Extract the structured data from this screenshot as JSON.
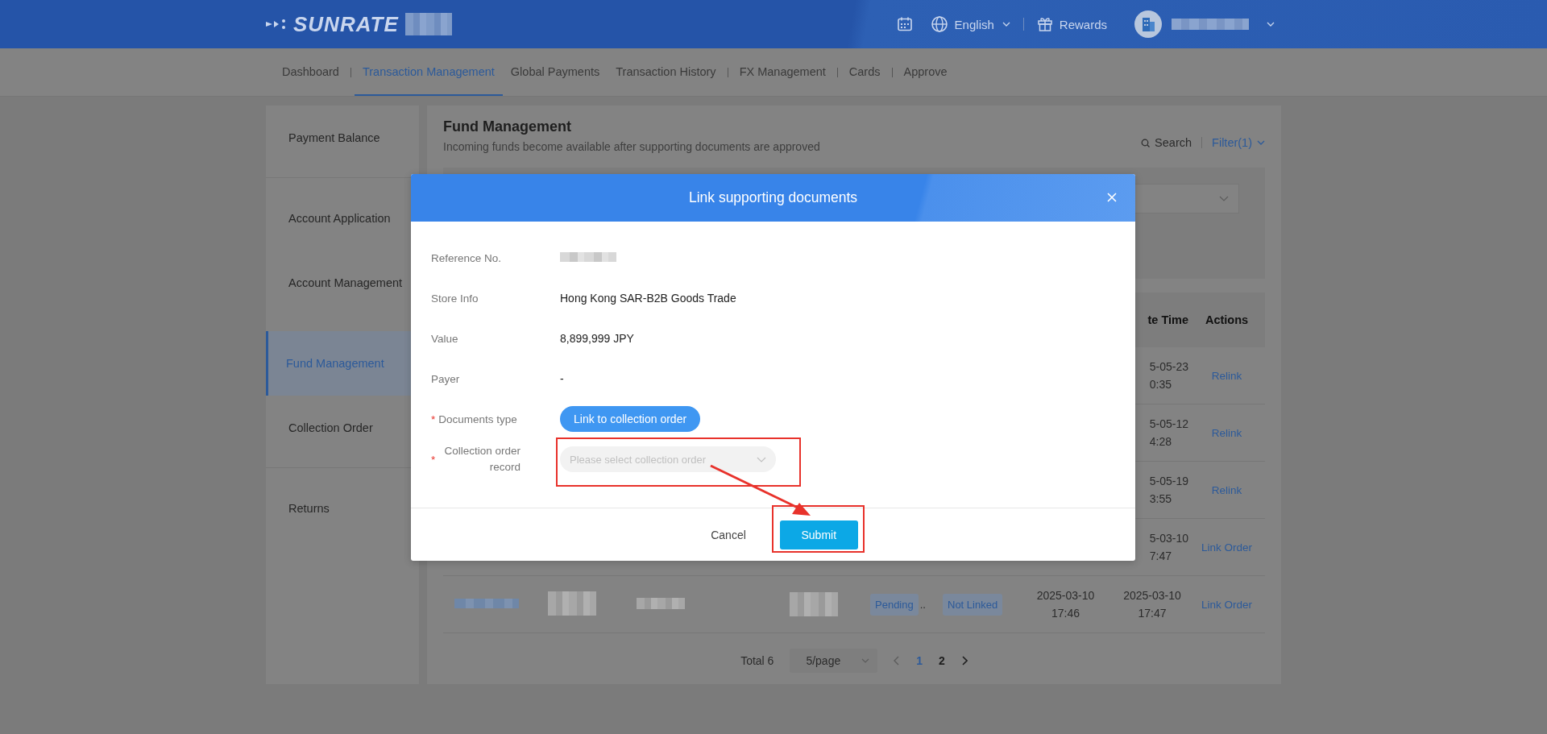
{
  "header": {
    "logo": "SUNRATE",
    "language": "English",
    "rewards": "Rewards"
  },
  "nav": [
    {
      "label": "Dashboard",
      "selected": false,
      "divider": true
    },
    {
      "label": "Transaction Management",
      "selected": true,
      "divider": false
    },
    {
      "label": "Global Payments",
      "selected": false,
      "divider": false
    },
    {
      "label": "Transaction History",
      "selected": false,
      "divider": true
    },
    {
      "label": "FX Management",
      "selected": false,
      "divider": true
    },
    {
      "label": "Cards",
      "selected": false,
      "divider": true
    },
    {
      "label": "Approve",
      "selected": false,
      "divider": false
    }
  ],
  "sidebar": [
    {
      "label": "Payment Balance",
      "selected": false,
      "divider": true
    },
    {
      "label": "Account Application",
      "selected": false,
      "divider": false
    },
    {
      "label": "Account Management",
      "selected": false,
      "divider": false
    },
    {
      "label": "Fund Management",
      "selected": true,
      "divider": false
    },
    {
      "label": "Collection Order",
      "selected": false,
      "divider": true
    },
    {
      "label": "Returns",
      "selected": false,
      "divider": false
    }
  ],
  "page": {
    "title": "Fund Management",
    "subtitle": "Incoming funds become available after supporting documents are approved",
    "search": "Search",
    "filter": "Filter(1)"
  },
  "table": {
    "columns": [
      "te Time",
      "Actions"
    ],
    "rows": [
      {
        "kind": "covered",
        "create_time": [
          "5-05-23",
          "0:35"
        ],
        "action": "Relink"
      },
      {
        "kind": "covered",
        "create_time": [
          "5-05-12",
          "4:28"
        ],
        "action": "Relink"
      },
      {
        "kind": "covered",
        "create_time": [
          "5-05-19",
          "3:55"
        ],
        "action": "Relink"
      },
      {
        "kind": "covered",
        "create_time": [
          "5-03-10",
          "7:47"
        ],
        "action": "Link Order"
      },
      {
        "kind": "full",
        "status": "Pending",
        "status_more": "..",
        "link_status": "Not Linked",
        "time": [
          "2025-03-10",
          "17:46"
        ],
        "create_time": [
          "2025-03-10",
          "17:47"
        ],
        "action": "Link Order"
      }
    ]
  },
  "pagination": {
    "total": "Total 6",
    "page_size": "5/page",
    "pages": [
      {
        "label": "1",
        "selected": true
      },
      {
        "label": "2",
        "selected": false
      }
    ]
  },
  "modal": {
    "title": "Link supporting documents",
    "required_mark": "*",
    "fields": [
      {
        "label": "Reference No.",
        "kind": "redacted",
        "required": false
      },
      {
        "label": "Store Info",
        "kind": "text",
        "required": false,
        "value": "Hong Kong SAR-B2B Goods Trade"
      },
      {
        "label": "Value",
        "kind": "text",
        "required": false,
        "value": "8,899,999 JPY"
      },
      {
        "label": "Payer",
        "kind": "text",
        "required": false,
        "value": "-"
      },
      {
        "label": "Documents type",
        "kind": "pill",
        "required": true,
        "value": "Link to collection order"
      },
      {
        "label": "Collection order record",
        "kind": "select",
        "required": true,
        "placeholder": "Please select collection order"
      }
    ],
    "cancel": "Cancel",
    "submit": "Submit"
  }
}
